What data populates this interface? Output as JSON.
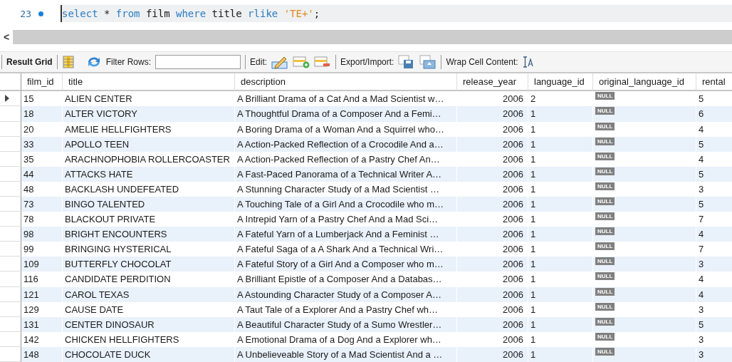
{
  "editor": {
    "line_number": "23",
    "tokens": [
      {
        "kind": "keyword",
        "text": "select"
      },
      {
        "kind": "plain",
        "text": "*"
      },
      {
        "kind": "keyword",
        "text": "from"
      },
      {
        "kind": "plain",
        "text": "film"
      },
      {
        "kind": "keyword",
        "text": "where"
      },
      {
        "kind": "plain",
        "text": "title"
      },
      {
        "kind": "keyword",
        "text": "rlike"
      },
      {
        "kind": "string",
        "text": "'TE+'"
      },
      {
        "kind": "punct",
        "text": ";"
      }
    ]
  },
  "scroll_left": "<",
  "toolbar": {
    "result_grid": "Result Grid",
    "filter_label": "Filter Rows:",
    "edit_label": "Edit:",
    "export_label": "Export/Import:",
    "wrap_label": "Wrap Cell Content:"
  },
  "table": {
    "columns": [
      "film_id",
      "title",
      "description",
      "release_year",
      "language_id",
      "original_language_id",
      "rental"
    ],
    "rows": [
      {
        "selected": true,
        "cells": [
          "15",
          "ALIEN CENTER",
          "A Brilliant Drama of a Cat And a Mad Scientist w…",
          "2006",
          "2",
          "NULL",
          "5"
        ]
      },
      {
        "selected": false,
        "cells": [
          "18",
          "ALTER VICTORY",
          "A Thoughtful Drama of a Composer And a Femi…",
          "2006",
          "1",
          "NULL",
          "6"
        ]
      },
      {
        "selected": false,
        "cells": [
          "20",
          "AMELIE HELLFIGHTERS",
          "A Boring Drama of a Woman And a Squirrel who…",
          "2006",
          "1",
          "NULL",
          "4"
        ]
      },
      {
        "selected": false,
        "cells": [
          "33",
          "APOLLO TEEN",
          "A Action-Packed Reflection of a Crocodile And a…",
          "2006",
          "1",
          "NULL",
          "5"
        ]
      },
      {
        "selected": false,
        "cells": [
          "35",
          "ARACHNOPHOBIA ROLLERCOASTER",
          "A Action-Packed Reflection of a Pastry Chef An…",
          "2006",
          "1",
          "NULL",
          "4"
        ]
      },
      {
        "selected": false,
        "cells": [
          "44",
          "ATTACKS HATE",
          "A Fast-Paced Panorama of a Technical Writer A…",
          "2006",
          "1",
          "NULL",
          "5"
        ]
      },
      {
        "selected": false,
        "cells": [
          "48",
          "BACKLASH UNDEFEATED",
          "A Stunning Character Study of a Mad Scientist …",
          "2006",
          "1",
          "NULL",
          "3"
        ]
      },
      {
        "selected": false,
        "cells": [
          "73",
          "BINGO TALENTED",
          "A Touching Tale of a Girl And a Crocodile who m…",
          "2006",
          "1",
          "NULL",
          "5"
        ]
      },
      {
        "selected": false,
        "cells": [
          "78",
          "BLACKOUT PRIVATE",
          "A Intrepid Yarn of a Pastry Chef And a Mad Sci…",
          "2006",
          "1",
          "NULL",
          "7"
        ]
      },
      {
        "selected": false,
        "cells": [
          "98",
          "BRIGHT ENCOUNTERS",
          "A Fateful Yarn of a Lumberjack And a Feminist …",
          "2006",
          "1",
          "NULL",
          "4"
        ]
      },
      {
        "selected": false,
        "cells": [
          "99",
          "BRINGING HYSTERICAL",
          "A Fateful Saga of a A Shark And a Technical Wri…",
          "2006",
          "1",
          "NULL",
          "7"
        ]
      },
      {
        "selected": false,
        "cells": [
          "109",
          "BUTTERFLY CHOCOLAT",
          "A Fateful Story of a Girl And a Composer who m…",
          "2006",
          "1",
          "NULL",
          "3"
        ]
      },
      {
        "selected": false,
        "cells": [
          "116",
          "CANDIDATE PERDITION",
          "A Brilliant Epistle of a Composer And a Databas…",
          "2006",
          "1",
          "NULL",
          "4"
        ]
      },
      {
        "selected": false,
        "cells": [
          "121",
          "CAROL TEXAS",
          "A Astounding Character Study of a Composer A…",
          "2006",
          "1",
          "NULL",
          "4"
        ]
      },
      {
        "selected": false,
        "cells": [
          "129",
          "CAUSE DATE",
          "A Taut Tale of a Explorer And a Pastry Chef wh…",
          "2006",
          "1",
          "NULL",
          "3"
        ]
      },
      {
        "selected": false,
        "cells": [
          "131",
          "CENTER DINOSAUR",
          "A Beautiful Character Study of a Sumo Wrestler…",
          "2006",
          "1",
          "NULL",
          "5"
        ]
      },
      {
        "selected": false,
        "cells": [
          "142",
          "CHICKEN HELLFIGHTERS",
          "A Emotional Drama of a Dog And a Explorer wh…",
          "2006",
          "1",
          "NULL",
          "3"
        ]
      },
      {
        "selected": false,
        "cells": [
          "148",
          "CHOCOLATE DUCK",
          "A Unbelieveable Story of a Mad Scientist And a …",
          "2006",
          "1",
          "NULL",
          "3"
        ]
      }
    ]
  }
}
